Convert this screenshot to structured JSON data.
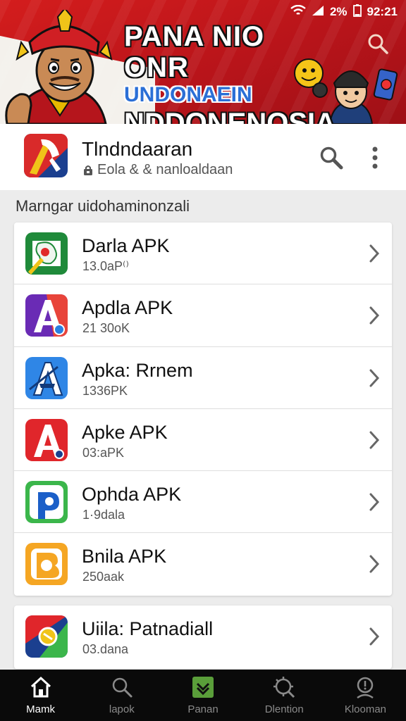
{
  "status_bar": {
    "battery": "2%",
    "time": "92:21"
  },
  "banner": {
    "line1": "PANA NIO ONR",
    "line2": "UNDONAEIN",
    "line3": "NDDONENOSIA"
  },
  "app": {
    "name": "Tlndndaaran",
    "subtitle": "Eola & & nanloaldaan"
  },
  "section_title": "Marngar uidohaminonzali",
  "apps": [
    {
      "name": "Darla APK",
      "size": "13.0aP⁽⁾",
      "icon": "map-pin-icon"
    },
    {
      "name": "Apdla APK",
      "size": "21 30oK",
      "icon": "letter-a-icon"
    },
    {
      "name": "Apka: Rrnem",
      "size": "1336PK",
      "icon": "letter-a-blue-icon"
    },
    {
      "name": "Apke APK",
      "size": "03:aPK",
      "icon": "letter-a-red-icon"
    },
    {
      "name": "Ophda APK",
      "size": "1·9dala",
      "icon": "letter-p-icon"
    },
    {
      "name": "Bnila APK",
      "size": "250aak",
      "icon": "letter-b-icon"
    }
  ],
  "apps_second": [
    {
      "name": "Uiila: Patnadiall",
      "size": "03.dana",
      "icon": "colorful-app-icon"
    }
  ],
  "nav": [
    {
      "label": "Mamk",
      "icon": "home-icon",
      "active": true
    },
    {
      "label": "lapok",
      "icon": "search-icon",
      "active": false
    },
    {
      "label": "Panan",
      "icon": "download-icon",
      "active": false
    },
    {
      "label": "Dlention",
      "icon": "settings-icon",
      "active": false
    },
    {
      "label": "Klooman",
      "icon": "profile-icon",
      "active": false
    }
  ]
}
